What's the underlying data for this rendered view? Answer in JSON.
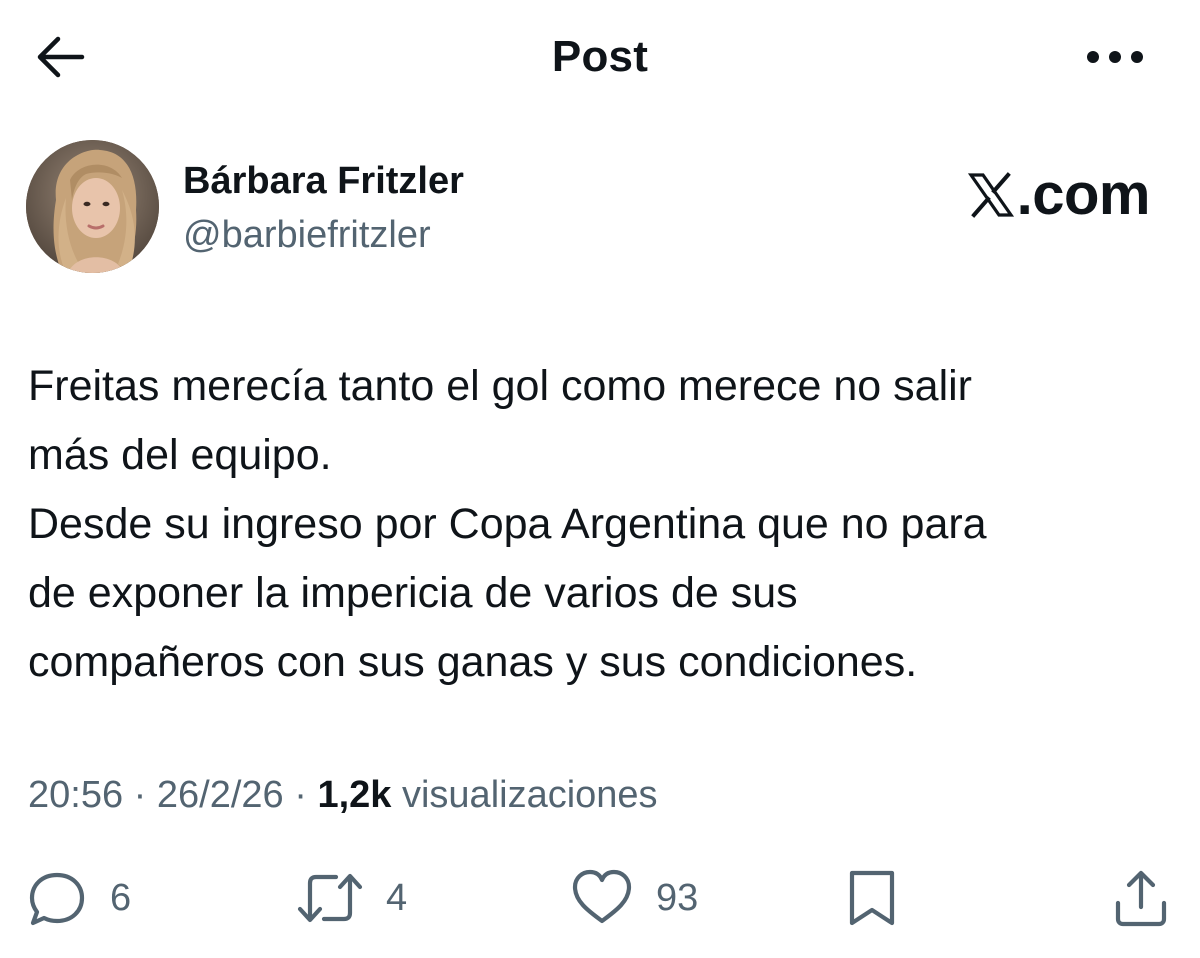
{
  "header": {
    "title": "Post",
    "back_icon": "arrow-left-icon",
    "more_icon": "more-horizontal-icon"
  },
  "author": {
    "name": "Bárbara Fritzler",
    "handle": "@barbiefritzler",
    "avatar_icon": "profile-photo"
  },
  "source": {
    "brand_suffix": ".com",
    "logo_icon": "x-logo-icon"
  },
  "tweet": {
    "lines": [
      "Freitas merecía tanto el gol como merece no salir",
      "más del equipo.",
      "Desde su ingreso por Copa Argentina que no para",
      "de exponer la impericia de varios de sus",
      "compañeros con sus ganas y sus condiciones."
    ]
  },
  "meta": {
    "time": "20:56",
    "separator": "·",
    "date": "26/2/26",
    "views_count": "1,2k",
    "views_label": "visualizaciones"
  },
  "actions": {
    "reply": {
      "icon": "reply-icon",
      "count": "6"
    },
    "repost": {
      "icon": "repost-icon",
      "count": "4"
    },
    "like": {
      "icon": "heart-icon",
      "count": "93"
    },
    "bookmark": {
      "icon": "bookmark-icon"
    },
    "share": {
      "icon": "share-icon"
    }
  },
  "colors": {
    "text_primary": "#0f1419",
    "text_secondary": "#536471",
    "background": "#ffffff"
  }
}
